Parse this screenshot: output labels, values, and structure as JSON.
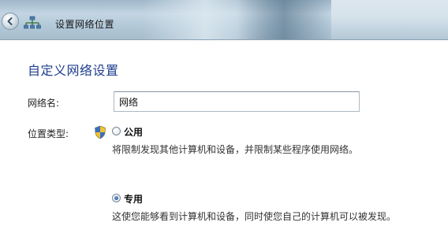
{
  "titlebar": {
    "title": "设置网络位置",
    "back_icon": "back-arrow-icon",
    "network_icon": "network-icon"
  },
  "main": {
    "heading": "自定义网络设置",
    "network_name": {
      "label": "网络名:",
      "value": "网络"
    },
    "location_type": {
      "label": "位置类型:",
      "shield_icon": "uac-shield-icon",
      "options": [
        {
          "label": "公用",
          "description": "将限制发现其他计算机和设备，并限制某些程序使用网络。",
          "selected": false
        },
        {
          "label": "专用",
          "description": "这使您能够看到计算机和设备，同时使您自己的计算机可以被发现。",
          "selected": true
        }
      ]
    }
  },
  "colors": {
    "heading": "#1e3e8c",
    "radio_selected": "#1d4f91"
  }
}
